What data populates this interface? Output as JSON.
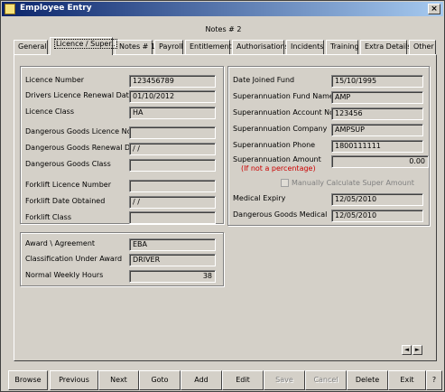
{
  "window": {
    "title": "Employee Entry",
    "close_label": "×"
  },
  "notes_label": "Notes # 2",
  "tabs": [
    "General",
    "Licence / Super..",
    "Notes # 1",
    "Payroll",
    "Entitlements",
    "Authorisations",
    "Incidents",
    "Training",
    "Extra Details",
    "Other"
  ],
  "active_tab": "Licence / Super..",
  "licence": {
    "licence_number_label": "Licence Number",
    "licence_number": "123456789",
    "renewal_label": "Drivers Licence Renewal Date",
    "renewal_date": "01/10/2012",
    "class_label": "Licence Class",
    "class": "HA",
    "dg_licence_label": "Dangerous Goods Licence No.",
    "dg_licence": "",
    "dg_renewal_label": "Dangerous Goods Renewal Date",
    "dg_renewal": " /  /",
    "dg_class_label": "Dangerous Goods Class",
    "dg_class": "",
    "forklift_number_label": "Forklift Licence Number",
    "forklift_number": "",
    "forklift_date_label": "Forklift Date Obtained",
    "forklift_date": " /  /",
    "forklift_class_label": "Forklift Class",
    "forklift_class": ""
  },
  "award": {
    "award_label": "Award \\ Agreement",
    "award": "EBA",
    "classification_label": "Classification Under Award",
    "classification": "DRIVER",
    "hours_label": "Normal Weekly Hours",
    "hours": "38"
  },
  "super": {
    "date_joined_label": "Date Joined Fund",
    "date_joined": "15/10/1995",
    "fund_name_label": "Superannuation Fund Name",
    "fund_name": "AMP",
    "account_label": "Superannuation Account No.",
    "account": "123456",
    "company_label": "Superannuation Company",
    "company": "AMPSUP",
    "phone_label": "Superannuation Phone",
    "phone": "1800111111",
    "amount_label": "Superannuation  Amount",
    "amount_note": "(If not a percentage)",
    "amount": "0.00",
    "manual_calc_label": "Manually Calculate Super Amount",
    "medical_label": "Medical Expiry",
    "medical": "12/05/2010",
    "dg_medical_label": "Dangerous Goods Medical",
    "dg_medical": "12/05/2010"
  },
  "nav_arrows": {
    "prev": "◄",
    "next": "►"
  },
  "buttons": {
    "browse": "Browse",
    "previous": "Previous",
    "next": "Next",
    "goto": "Goto",
    "add": "Add",
    "edit": "Edit",
    "save": "Save",
    "cancel": "Cancel",
    "delete": "Delete",
    "exit": "Exit",
    "help": "?"
  }
}
